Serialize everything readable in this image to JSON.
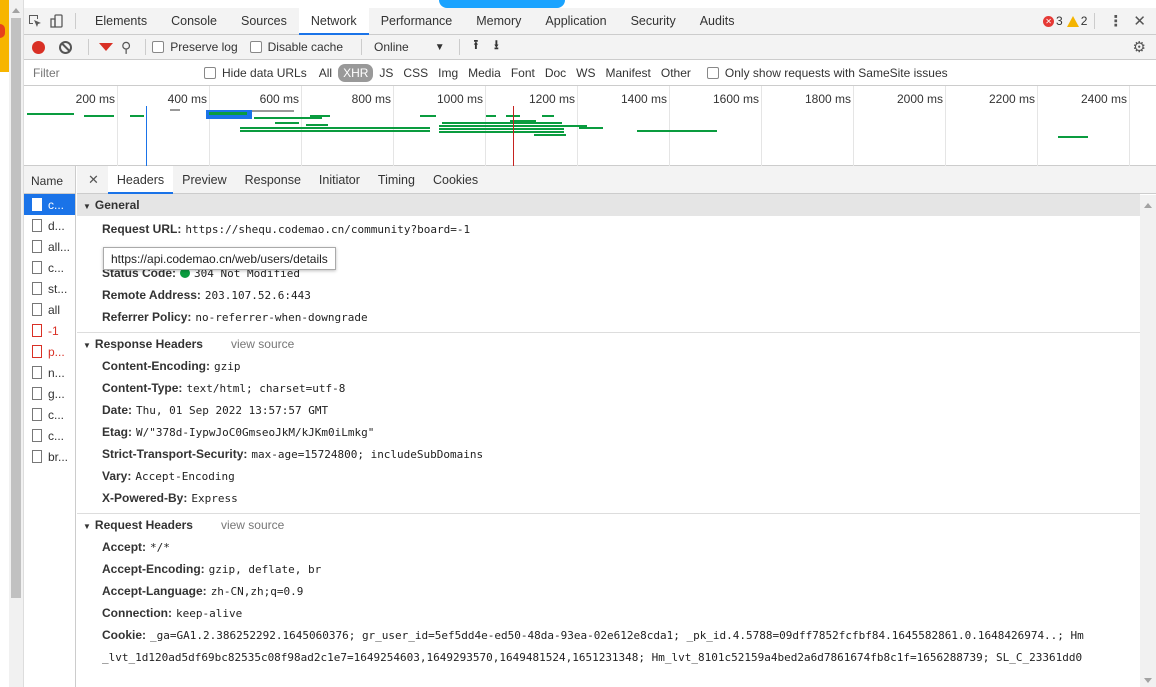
{
  "tabs": [
    "Elements",
    "Console",
    "Sources",
    "Network",
    "Performance",
    "Memory",
    "Application",
    "Security",
    "Audits"
  ],
  "status": {
    "errors": "3",
    "warnings": "2"
  },
  "toolbar": {
    "preserve_log": "Preserve log",
    "disable_cache": "Disable cache",
    "throttle": "Online"
  },
  "filter": {
    "placeholder": "Filter",
    "hide_data_urls": "Hide data URLs",
    "types": [
      "All",
      "XHR",
      "JS",
      "CSS",
      "Img",
      "Media",
      "Font",
      "Doc",
      "WS",
      "Manifest",
      "Other"
    ],
    "active_type": "XHR",
    "samesite": "Only show requests with SameSite issues"
  },
  "overview": {
    "ticks": [
      "200 ms",
      "400 ms",
      "600 ms",
      "800 ms",
      "1000 ms",
      "1200 ms",
      "1400 ms",
      "1600 ms",
      "1800 ms",
      "2000 ms",
      "2200 ms",
      "2400 ms"
    ]
  },
  "names": {
    "header": "Name",
    "rows": [
      "c...",
      "d...",
      "all...",
      "c...",
      "st...",
      "all",
      "-1",
      "p...",
      "n...",
      "g...",
      "c...",
      "c...",
      "br..."
    ]
  },
  "detail_tabs": [
    "Headers",
    "Preview",
    "Response",
    "Initiator",
    "Timing",
    "Cookies"
  ],
  "tooltip": "https://api.codemao.cn/web/users/details",
  "general": {
    "title": "General",
    "request_url_k": "Request URL:",
    "request_url_v": "https://shequ.codemao.cn/community?board=-1",
    "status_code_k": "Status Code:",
    "status_code_v": "304 Not Modified",
    "remote_address_k": "Remote Address:",
    "remote_address_v": "203.107.52.6:443",
    "referrer_policy_k": "Referrer Policy:",
    "referrer_policy_v": "no-referrer-when-downgrade"
  },
  "response_headers": {
    "title": "Response Headers",
    "view_source": "view source",
    "items": [
      {
        "k": "Content-Encoding:",
        "v": "gzip"
      },
      {
        "k": "Content-Type:",
        "v": "text/html; charset=utf-8"
      },
      {
        "k": "Date:",
        "v": "Thu, 01 Sep 2022 13:57:57 GMT"
      },
      {
        "k": "Etag:",
        "v": "W/\"378d-IypwJoC0GmseoJkM/kJKm0iLmkg\""
      },
      {
        "k": "Strict-Transport-Security:",
        "v": "max-age=15724800; includeSubDomains"
      },
      {
        "k": "Vary:",
        "v": "Accept-Encoding"
      },
      {
        "k": "X-Powered-By:",
        "v": "Express"
      }
    ]
  },
  "request_headers": {
    "title": "Request Headers",
    "view_source": "view source",
    "items": [
      {
        "k": "Accept:",
        "v": "*/*"
      },
      {
        "k": "Accept-Encoding:",
        "v": "gzip, deflate, br"
      },
      {
        "k": "Accept-Language:",
        "v": "zh-CN,zh;q=0.9"
      },
      {
        "k": "Connection:",
        "v": "keep-alive"
      },
      {
        "k": "Cookie:",
        "v": "_ga=GA1.2.386252292.1645060376; gr_user_id=5ef5dd4e-ed50-48da-93ea-02e612e8cda1; _pk_id.4.5788=09dff7852fcfbf84.1645582861.0.1648426974..; Hm"
      },
      {
        "k": "",
        "v": "_lvt_1d120ad5df69bc82535c08f98ad2c1e7=1649254603,1649293570,1649481524,1651231348; Hm_lvt_8101c52159a4bed2a6d7861674fb8c1f=1656288739; SL_C_23361dd0"
      }
    ]
  },
  "colors": {
    "accent": "#1a73e8",
    "bar": "#0a9c3f",
    "record": "#d93025"
  }
}
